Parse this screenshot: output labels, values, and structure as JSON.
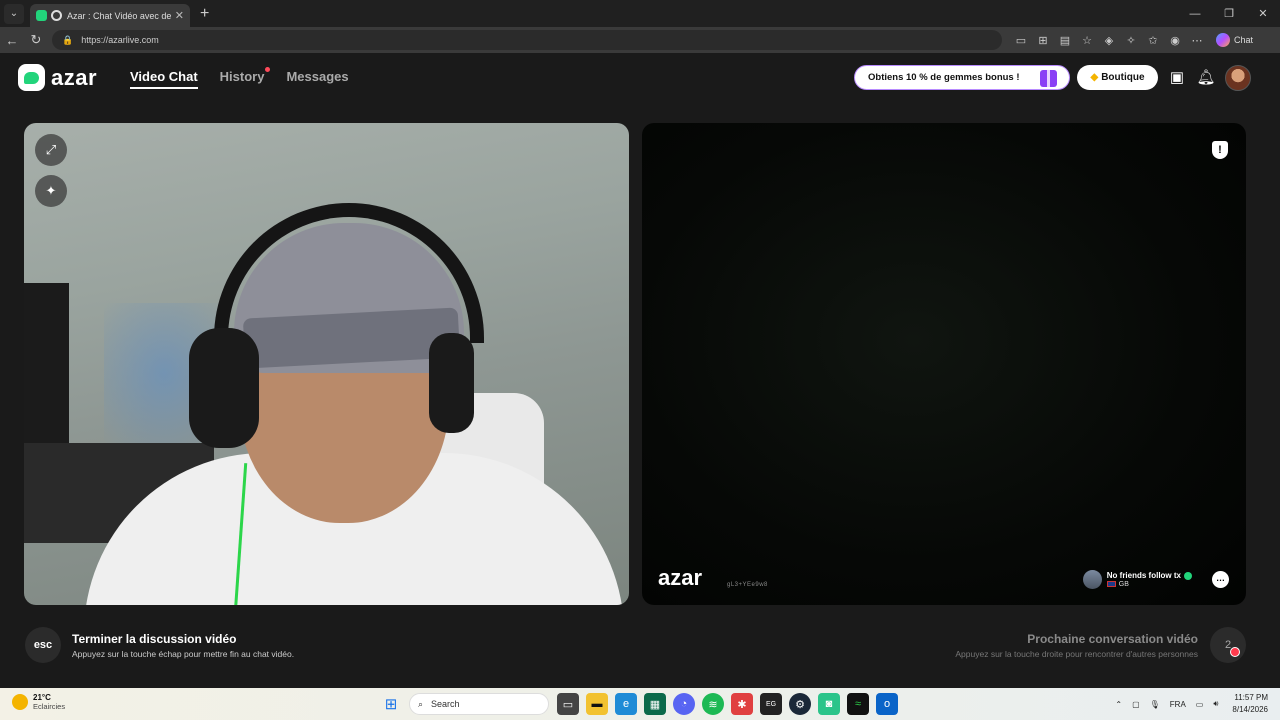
{
  "browser": {
    "tab_title": "Azar : Chat Vidéo avec de nou",
    "url": "https://azarlive.com",
    "copilot_label": "Chat"
  },
  "header": {
    "logo_text": "azar",
    "nav": [
      {
        "label": "Video Chat"
      },
      {
        "label": "History"
      },
      {
        "label": "Messages"
      }
    ],
    "promo_label": "Obtiens 10 % de gemmes bonus !",
    "shop_label": "Boutique"
  },
  "remote": {
    "watermark": "azar",
    "watermark_id": "gL3+YEe9w8",
    "peer_name": "No friends follow tx",
    "peer_country": "GB"
  },
  "footer": {
    "esc_label": "esc",
    "end_title": "Terminer la discussion vidéo",
    "end_sub": "Appuyez sur la touche échap pour mettre fin au chat vidéo.",
    "next_title": "Prochaine conversation vidéo",
    "next_sub": "Appuyez sur la touche droite pour rencontrer d'autres personnes",
    "next_count": "2"
  },
  "taskbar": {
    "temp": "21°C",
    "weather": "Eclaircies",
    "search_placeholder": "Search",
    "lang": "FRA",
    "time": "11:57 PM",
    "date": "8/14/2026"
  },
  "colors": {
    "brand": "#22d47b",
    "background": "#1a1a1a",
    "notification": "#ff4a5a"
  }
}
